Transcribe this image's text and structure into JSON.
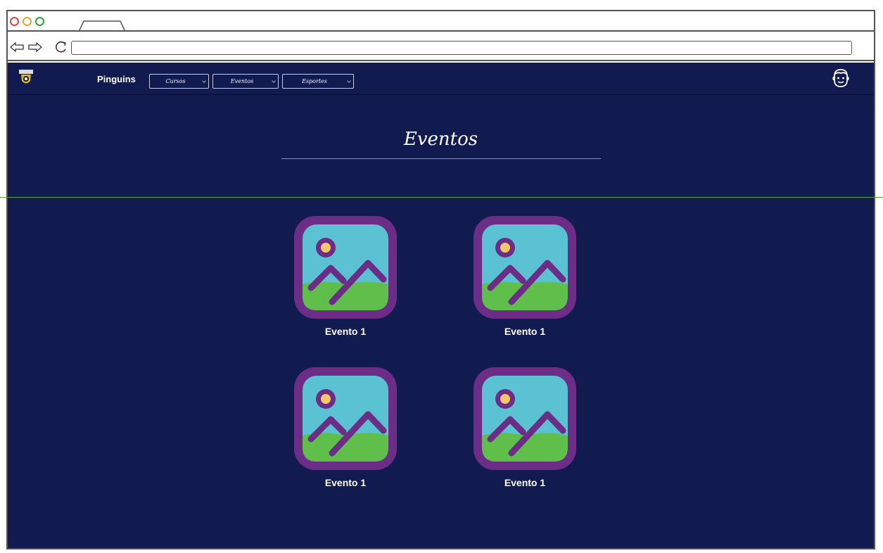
{
  "navbar": {
    "brand": "Pinguins",
    "menus": [
      {
        "label": "Cursos"
      },
      {
        "label": "Eventos"
      },
      {
        "label": "Esportes"
      }
    ]
  },
  "page": {
    "title": "Eventos"
  },
  "events": [
    {
      "label": "Evento 1"
    },
    {
      "label": "Evento 1"
    },
    {
      "label": "Evento 1"
    },
    {
      "label": "Evento 1"
    }
  ],
  "colors": {
    "page_background": "#121b50",
    "thumbnail_frame": "#6b2d86",
    "thumbnail_sky": "#5bc2d4",
    "thumbnail_grass": "#5fbf4a",
    "sun": "#f7c56b",
    "guide_line": "#4caf2a"
  },
  "icons": {
    "logo": "penguin-logo-icon",
    "user": "user-avatar-icon",
    "thumbnail": "image-placeholder-icon"
  }
}
